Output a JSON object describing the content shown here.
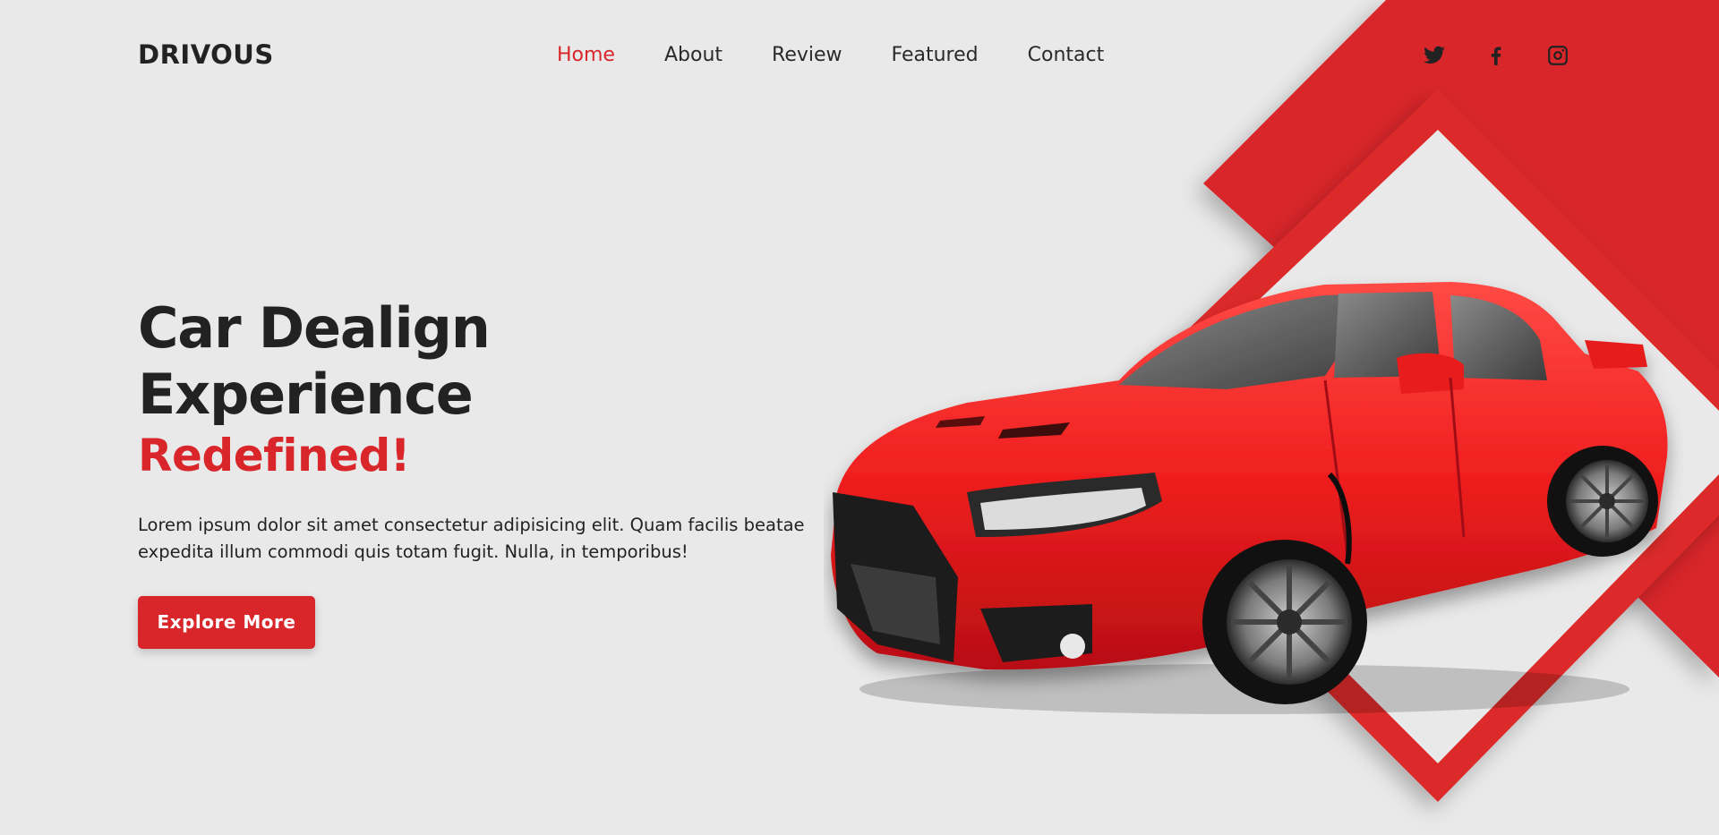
{
  "brand": "DRIVOUS",
  "nav": [
    {
      "label": "Home",
      "active": true
    },
    {
      "label": "About",
      "active": false
    },
    {
      "label": "Review",
      "active": false
    },
    {
      "label": "Featured",
      "active": false
    },
    {
      "label": "Contact",
      "active": false
    }
  ],
  "social": [
    "twitter-icon",
    "facebook-icon",
    "instagram-icon"
  ],
  "hero": {
    "title": "Car Dealign Experience",
    "subtitle": "Redefined!",
    "description": "Lorem ipsum dolor sit amet consectetur adipisicing elit. Quam facilis beatae expedita illum commodi quis totam fugit. Nulla, in temporibus!",
    "cta": "Explore More"
  },
  "colors": {
    "accent": "#d9262a",
    "background": "#e9e9e9",
    "text": "#222222"
  }
}
